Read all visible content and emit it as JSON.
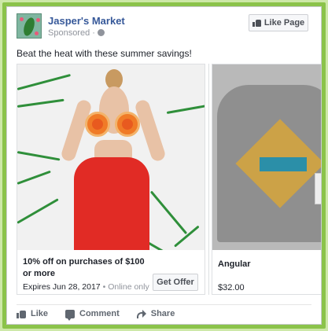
{
  "post": {
    "page_name": "Jasper's Market",
    "sponsored": "Sponsored",
    "like_page": "Like Page",
    "caption": "Beat the heat with these summer savings!"
  },
  "cards": [
    {
      "title": "10% off on purchases of $100 or more",
      "expires": "Expires Jun 28, 2017",
      "separator": "•",
      "availability": "Online only",
      "cta": "Get Offer"
    },
    {
      "title": "Angular",
      "price": "$32.00"
    }
  ],
  "actions": {
    "like": "Like",
    "comment": "Comment",
    "share": "Share"
  },
  "colors": {
    "link": "#365899",
    "frame": "#8bc34a"
  }
}
